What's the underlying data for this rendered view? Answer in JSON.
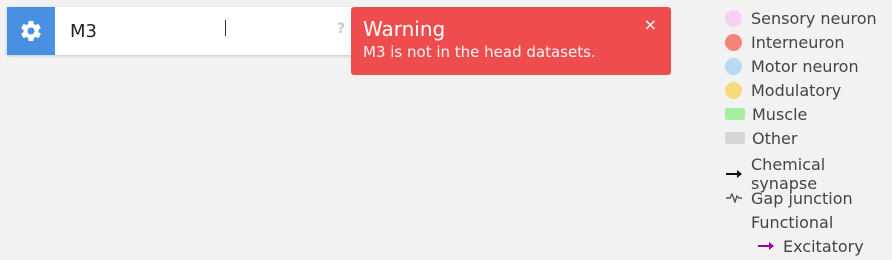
{
  "search": {
    "value": "M3",
    "help_label": "?"
  },
  "toast": {
    "title": "Warning",
    "message": "M3 is not in the head datasets.",
    "close_label": "×",
    "color": "#ef4d4d"
  },
  "legend": {
    "nodes": [
      {
        "label": "Sensory neuron",
        "color": "#f9d0f5"
      },
      {
        "label": "Interneuron",
        "color": "#f4837a"
      },
      {
        "label": "Motor neuron",
        "color": "#b7d9f2"
      },
      {
        "label": "Modulatory",
        "color": "#f6d978"
      }
    ],
    "tissues": [
      {
        "label": "Muscle",
        "color": "#a6eea0"
      },
      {
        "label": "Other",
        "color": "#d6d6d6"
      }
    ],
    "edges": {
      "chemical": "Chemical synapse",
      "gap": "Gap junction",
      "functional": "Functional",
      "excitatory": "Excitatory",
      "excitatory_color": "#a000a0"
    }
  },
  "accent_color": "#4a90e2"
}
